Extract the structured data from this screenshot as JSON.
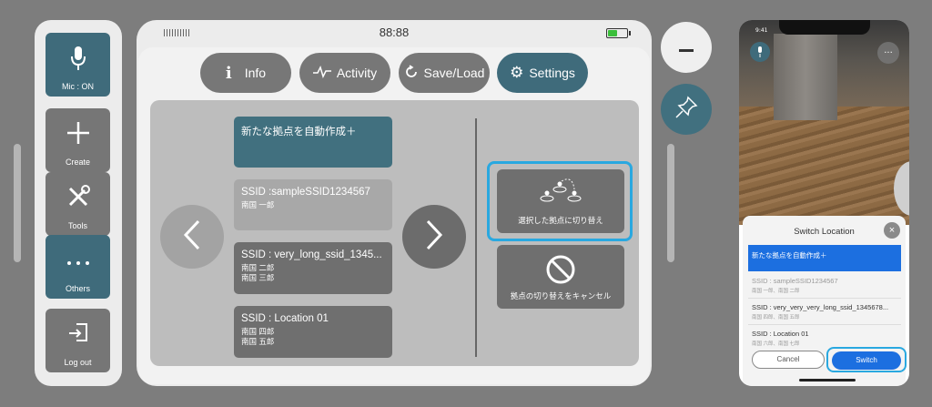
{
  "toolbar": {
    "items": [
      {
        "label": "Mic : ON",
        "icon": "microphone-icon"
      },
      {
        "label": "Create",
        "icon": "plus-icon"
      },
      {
        "label": "Tools",
        "icon": "tools-icon"
      },
      {
        "label": "Others",
        "icon": "ellipsis-icon"
      },
      {
        "label": "Log out",
        "icon": "logout-icon"
      }
    ]
  },
  "status": {
    "clock": "88:88",
    "battery_level": 0.45
  },
  "tabs": [
    {
      "label": "Info",
      "icon": "info-icon"
    },
    {
      "label": "Activity",
      "icon": "activity-icon"
    },
    {
      "label": "Save/Load",
      "icon": "save-load-icon"
    },
    {
      "label": "Settings",
      "icon": "gear-icon",
      "active": true
    }
  ],
  "locations": [
    {
      "title": "新たな拠点を自動作成＋",
      "sub": ""
    },
    {
      "title": "SSID :sampleSSID1234567",
      "sub": "南国 一郎"
    },
    {
      "title": "SSID : very_long_ssid_1345...",
      "sub": "南国 二郎\n南国 三郎"
    },
    {
      "title": "SSID : Location 01",
      "sub": "南国 四郎\n南国 五郎"
    }
  ],
  "actions": {
    "switch_label": "選択した拠点に切り替え",
    "cancel_label": "拠点の切り替えをキャンセル"
  },
  "phone": {
    "time": "9:41",
    "sheet_title": "Switch Location",
    "items": [
      {
        "title": "新たな拠点を自動作成＋",
        "sub": ""
      },
      {
        "title": "SSID : sampleSSID1234567",
        "sub": "南国 一郎、南国 二郎"
      },
      {
        "title": "SSID : very_very_very_long_ssid_1345678...",
        "sub": "南国 四郎、南国 五郎"
      },
      {
        "title": "SSID : Location 01",
        "sub": "南国 六郎、南国 七郎"
      }
    ],
    "cancel_label": "Cancel",
    "switch_label": "Switch"
  },
  "colors": {
    "teal": "#3f6b7b",
    "gray": "#767676",
    "highlight": "#29a8e0",
    "blue": "#1c6fe0"
  }
}
